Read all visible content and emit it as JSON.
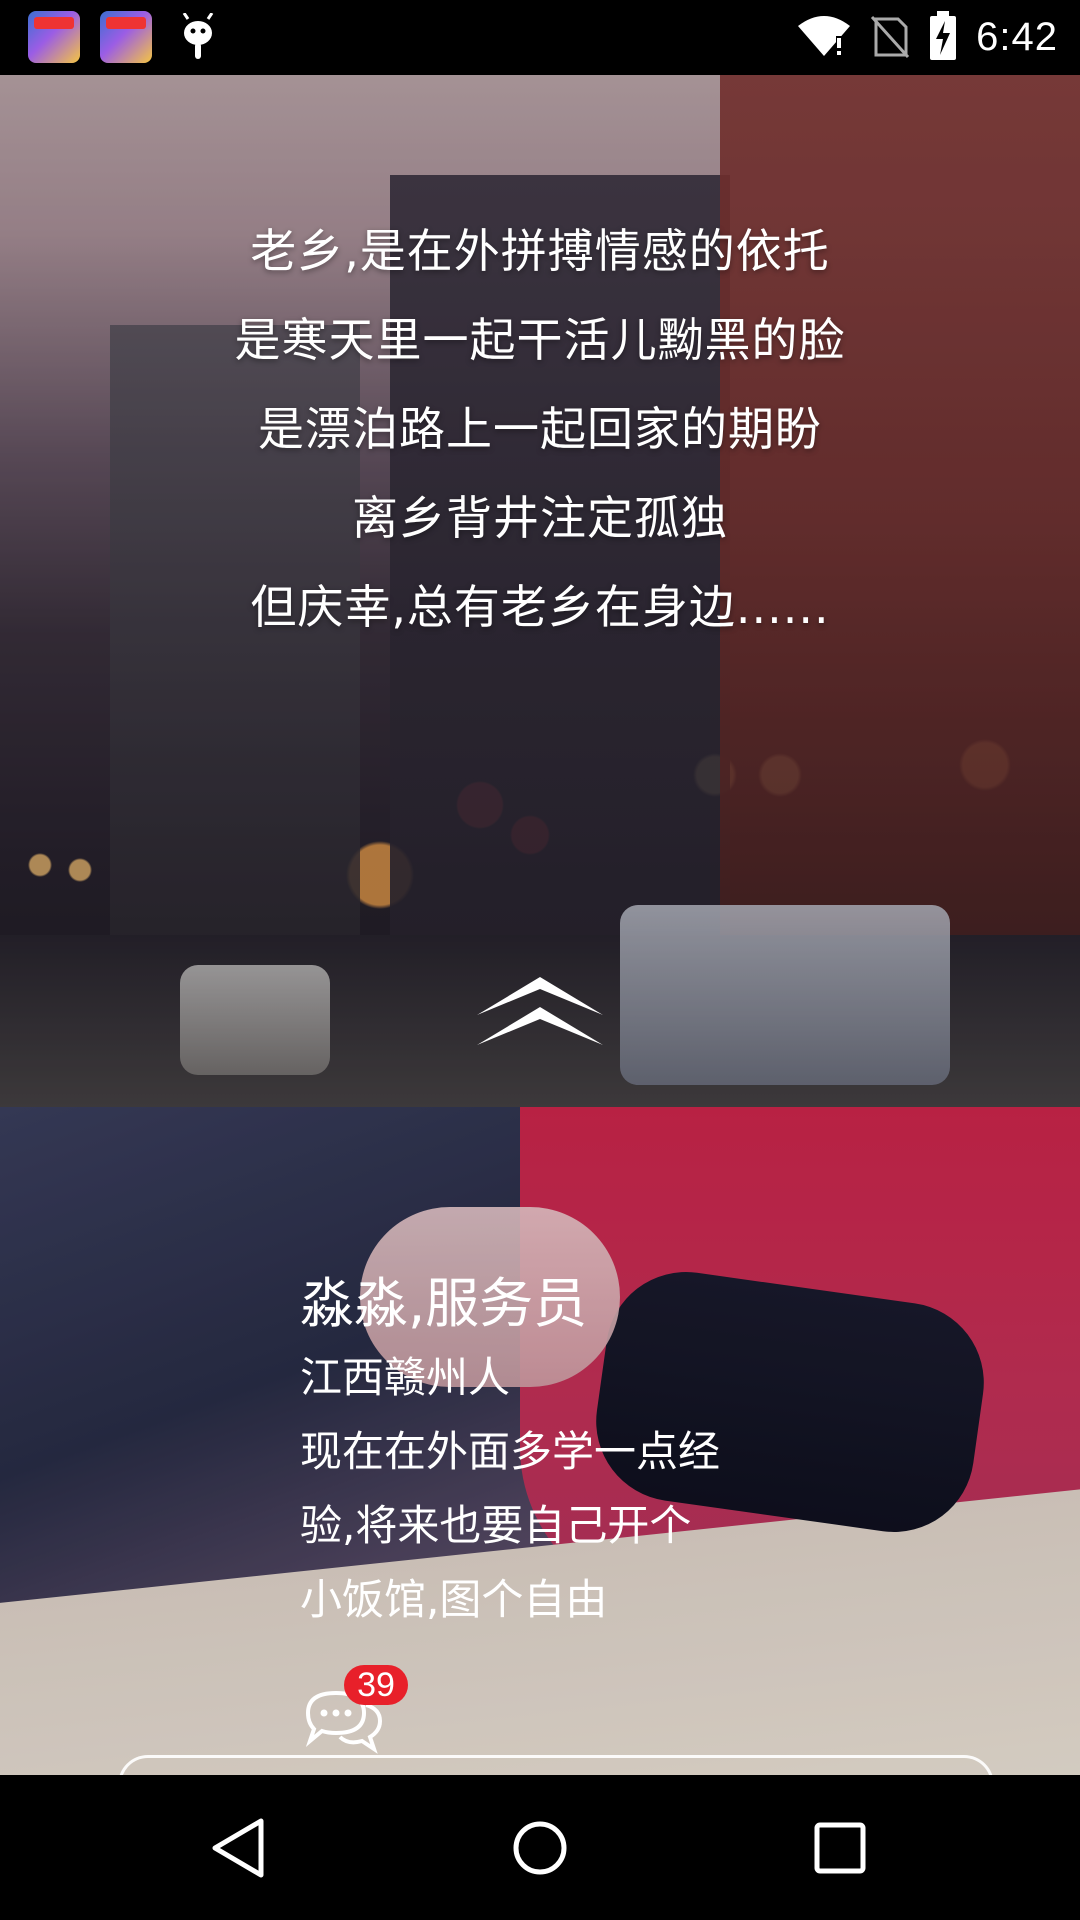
{
  "status_bar": {
    "time": "6:42",
    "left_icons": [
      "game-app-icon",
      "game-app-icon",
      "android-debug-icon"
    ],
    "right_icons": [
      "wifi-icon",
      "no-sim-icon",
      "battery-charging-icon"
    ]
  },
  "poem": {
    "lines": [
      "老乡,是在外拼搏情感的依托",
      "是寒天里一起干活儿黝黑的脸",
      "是漂泊路上一起回家的期盼",
      "离乡背井注定孤独",
      "但庆幸,总有老乡在身边......"
    ]
  },
  "profile": {
    "name": "淼淼,服务员",
    "lines": [
      "江西赣州人",
      "现在在外面多学一点经",
      "验,将来也要自己开个",
      "小饭馆,图个自由"
    ],
    "comment_count": "39"
  },
  "colors": {
    "badge": "#e8202a",
    "text": "#ffffff",
    "bar": "#000000"
  }
}
